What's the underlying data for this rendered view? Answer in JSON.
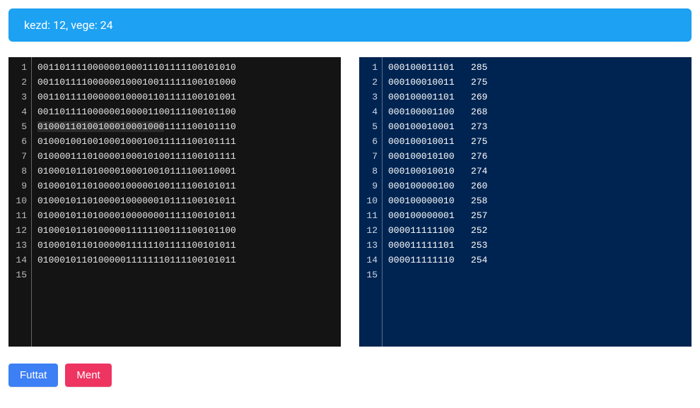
{
  "alert": {
    "text": "kezd: 12, vege: 24"
  },
  "left_editor": {
    "line_count": 15,
    "lines": [
      "001101111000000100011101111100101010",
      "001101111000000100010011111100101000",
      "001101111000000100001101111100101001",
      "001101111000000100001100111100101100",
      "010001101001000100010001111100101110",
      "010001001001000100010011111100101111",
      "010000111010000100010100111100101111",
      "010001011010000100010010111100110001",
      "010001011010000100000100111100101011",
      "010001011010000100000010111100101011",
      "010001011010000100000001111100101011",
      "010001011010000011111100111100101100",
      "010001011010000011111101111100101011",
      "010001011010000011111110111100101011"
    ],
    "selection_line_index": 4,
    "selection_text": "01000110100100010001000"
  },
  "right_editor": {
    "line_count": 15,
    "rows": [
      {
        "bits": "000100011101",
        "value": "285"
      },
      {
        "bits": "000100010011",
        "value": "275"
      },
      {
        "bits": "000100001101",
        "value": "269"
      },
      {
        "bits": "000100001100",
        "value": "268"
      },
      {
        "bits": "000100010001",
        "value": "273"
      },
      {
        "bits": "000100010011",
        "value": "275"
      },
      {
        "bits": "000100010100",
        "value": "276"
      },
      {
        "bits": "000100010010",
        "value": "274"
      },
      {
        "bits": "000100000100",
        "value": "260"
      },
      {
        "bits": "000100000010",
        "value": "258"
      },
      {
        "bits": "000100000001",
        "value": "257"
      },
      {
        "bits": "000011111100",
        "value": "252"
      },
      {
        "bits": "000011111101",
        "value": "253"
      },
      {
        "bits": "000011111110",
        "value": "254"
      }
    ]
  },
  "buttons": {
    "run": "Futtat",
    "save": "Ment"
  }
}
